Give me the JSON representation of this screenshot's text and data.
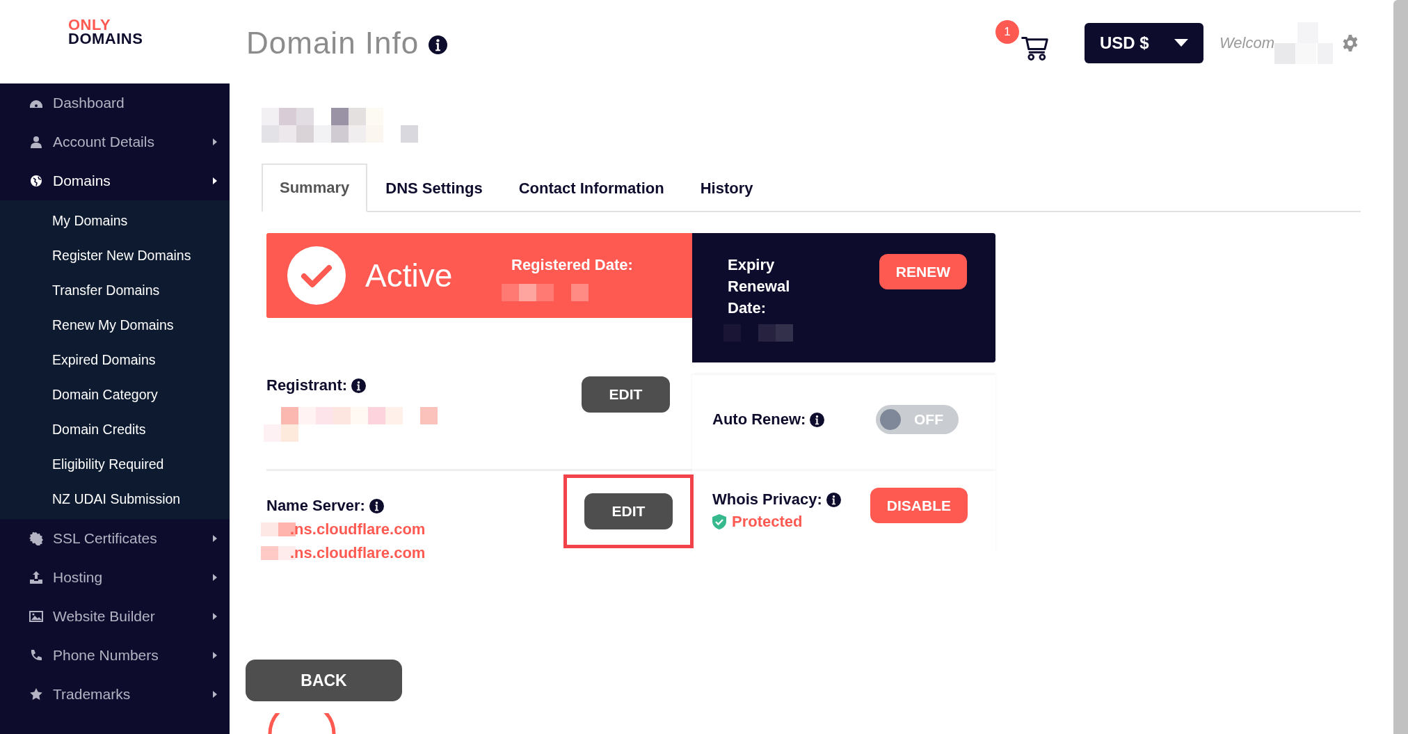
{
  "logo": {
    "top": "ONLY",
    "bottom": "DOMAINS"
  },
  "page_title": "Domain Info",
  "header": {
    "cart_count": "1",
    "currency": "USD $",
    "welcome": "Welcom"
  },
  "sidebar": {
    "items": [
      {
        "label": "Dashboard",
        "has_arrow": false,
        "selected": false
      },
      {
        "label": "Account Details",
        "has_arrow": true,
        "selected": false
      },
      {
        "label": "Domains",
        "has_arrow": true,
        "selected": true,
        "expanded": true,
        "children": [
          {
            "label": "My Domains",
            "selected": false
          },
          {
            "label": "Register New Domains",
            "selected": false
          },
          {
            "label": "Transfer Domains",
            "selected": false
          },
          {
            "label": "Renew My Domains",
            "selected": false
          },
          {
            "label": "Expired Domains",
            "selected": false
          },
          {
            "label": "Domain Category",
            "selected": false
          },
          {
            "label": "Domain Credits",
            "selected": false
          },
          {
            "label": "Eligibility Required",
            "selected": false
          },
          {
            "label": "NZ UDAI Submission",
            "selected": false
          }
        ]
      },
      {
        "label": "SSL Certificates",
        "has_arrow": true,
        "selected": false
      },
      {
        "label": "Hosting",
        "has_arrow": true,
        "selected": false
      },
      {
        "label": "Website Builder",
        "has_arrow": true,
        "selected": false
      },
      {
        "label": "Phone Numbers",
        "has_arrow": true,
        "selected": false
      },
      {
        "label": "Trademarks",
        "has_arrow": true,
        "selected": false
      }
    ]
  },
  "tabs": [
    {
      "label": "Summary",
      "selected": true
    },
    {
      "label": "DNS Settings",
      "selected": false
    },
    {
      "label": "Contact Information",
      "selected": false
    },
    {
      "label": "History",
      "selected": false
    }
  ],
  "status": {
    "state": "Active",
    "registered_label": "Registered Date:",
    "expiry_label": "Expiry Renewal Date:",
    "renew_button": "RENEW"
  },
  "registrant": {
    "label": "Registrant:",
    "button": "EDIT"
  },
  "name_server": {
    "label": "Name Server:",
    "button": "EDIT",
    "highlighted": true,
    "servers": [
      ".ns.cloudflare.com",
      ".ns.cloudflare.com"
    ]
  },
  "auto_renew": {
    "label": "Auto Renew:",
    "on": false,
    "state_text": "OFF"
  },
  "whois_privacy": {
    "label": "Whois Privacy:",
    "status": "Protected",
    "button": "DISABLE"
  },
  "back_button": "BACK"
}
